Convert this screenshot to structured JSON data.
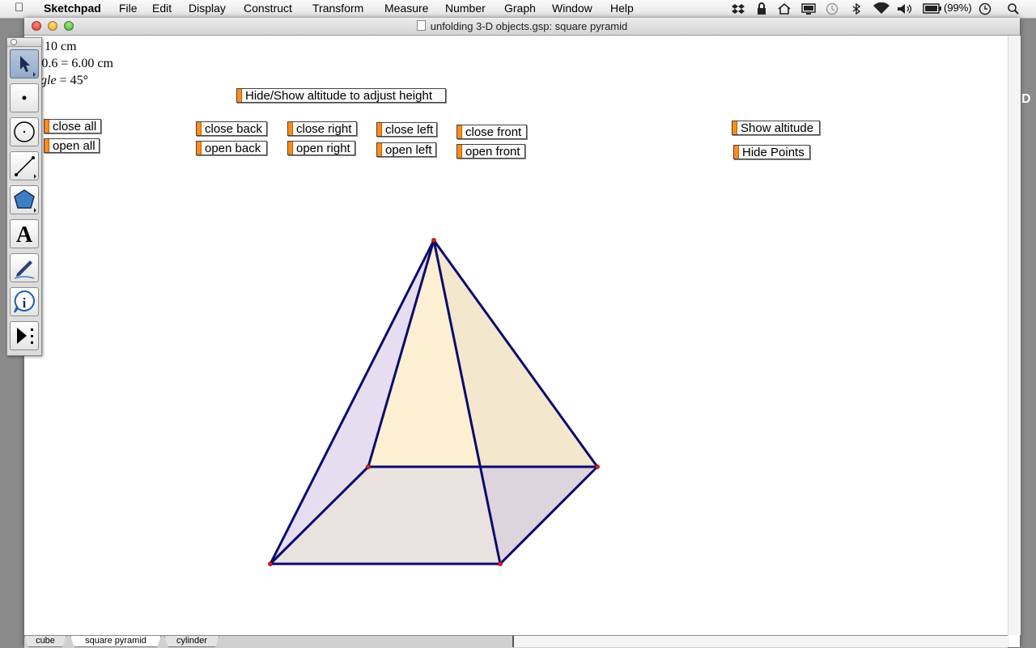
{
  "menubar": {
    "app_name": "Sketchpad",
    "menus": [
      "File",
      "Edit",
      "Display",
      "Construct",
      "Transform",
      "Measure",
      "Number",
      "Graph",
      "Window",
      "Help"
    ],
    "battery": "(99%)",
    "status_icons": [
      "dropbox-icon",
      "lock-icon",
      "home-sync-icon",
      "display-icon",
      "time-machine-icon",
      "bluetooth-icon",
      "wifi-icon",
      "volume-icon",
      "battery-icon",
      "clock-icon",
      "spotlight-icon"
    ]
  },
  "window": {
    "title": "unfolding 3-D objects.gsp: square pyramid"
  },
  "measurements": {
    "m1": "= 10 cm",
    "m2_prefix": "· 0.6 = 6.00 cm",
    "m3_italic": "ngle",
    "m3_rest": " = 45°"
  },
  "buttons": {
    "hide_show_altitude": "Hide/Show altitude to adjust height",
    "close_all": "close all",
    "open_all": "open all",
    "close_back": "close back",
    "open_back": "open back",
    "close_right": "close right",
    "open_right": "open right",
    "close_left": "close left",
    "open_left": "open left",
    "close_front": "close front",
    "open_front": "open front",
    "show_altitude": "Show altitude",
    "hide_points": "Hide Points"
  },
  "toolbox": {
    "tools": [
      "selection-arrow-tool",
      "point-tool",
      "compass-tool",
      "straightedge-tool",
      "polygon-tool",
      "text-tool",
      "marker-tool",
      "information-tool",
      "custom-tool"
    ],
    "selected": "selection-arrow-tool"
  },
  "tabs": {
    "pages": [
      "cube",
      "square pyramid",
      "cylinder"
    ],
    "active": "square pyramid"
  },
  "colors": {
    "edge": "#0a0a6e",
    "vertex": "#d81e1e",
    "face_left": "#e6def0",
    "face_back": "#fdf0d2",
    "face_right": "#f3e7cd",
    "face_front_right": "#ddd4dc",
    "face_base": "#eae2de",
    "button_marker": "#ff8c1a"
  }
}
